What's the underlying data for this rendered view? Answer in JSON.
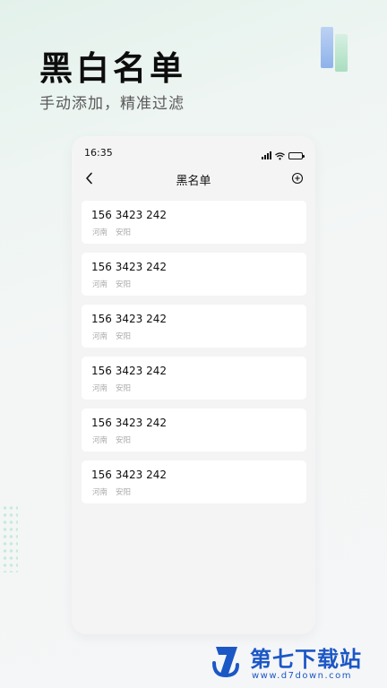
{
  "promo": {
    "headline": "黑白名单",
    "subheadline": "手动添加，精准过滤"
  },
  "phone": {
    "status_bar": {
      "time": "16:35"
    },
    "nav": {
      "title": "黑名单",
      "back_icon": "chevron-left-icon",
      "add_icon": "plus-circle-icon"
    },
    "blacklist": [
      {
        "number": "156 3423 242",
        "province": "河南",
        "city": "安阳"
      },
      {
        "number": "156 3423 242",
        "province": "河南",
        "city": "安阳"
      },
      {
        "number": "156 3423 242",
        "province": "河南",
        "city": "安阳"
      },
      {
        "number": "156 3423 242",
        "province": "河南",
        "city": "安阳"
      },
      {
        "number": "156 3423 242",
        "province": "河南",
        "city": "安阳"
      },
      {
        "number": "156 3423 242",
        "province": "河南",
        "city": "安阳"
      }
    ]
  },
  "watermark": {
    "title": "第七下载站",
    "url": "www.d7down.com"
  },
  "colors": {
    "watermark_blue": "#1c57c6",
    "bg_mint": "#e3f1eb",
    "card_bg": "#ffffff"
  }
}
